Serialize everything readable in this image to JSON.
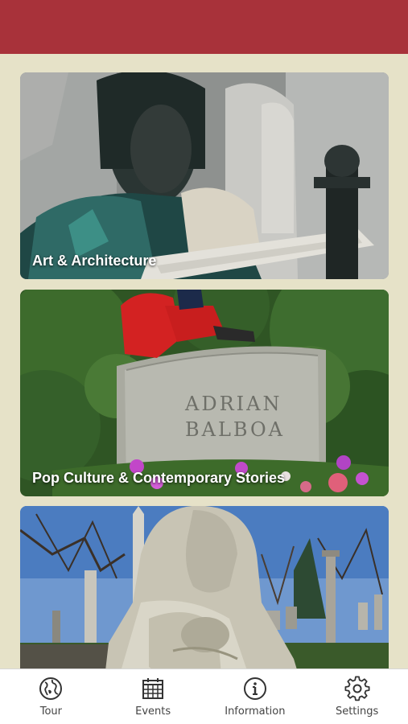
{
  "colors": {
    "header": "#a8323a",
    "background": "#e6e2c8",
    "tab_bar": "#ffffff",
    "tab_label": "#444444"
  },
  "cards": [
    {
      "title": "Art & Architecture"
    },
    {
      "title": "Pop Culture & Contemporary Stories"
    },
    {
      "title": ""
    }
  ],
  "tabs": [
    {
      "label": "Tour",
      "icon": "globe-icon"
    },
    {
      "label": "Events",
      "icon": "calendar-icon"
    },
    {
      "label": "Information",
      "icon": "info-icon"
    },
    {
      "label": "Settings",
      "icon": "gear-icon"
    }
  ]
}
